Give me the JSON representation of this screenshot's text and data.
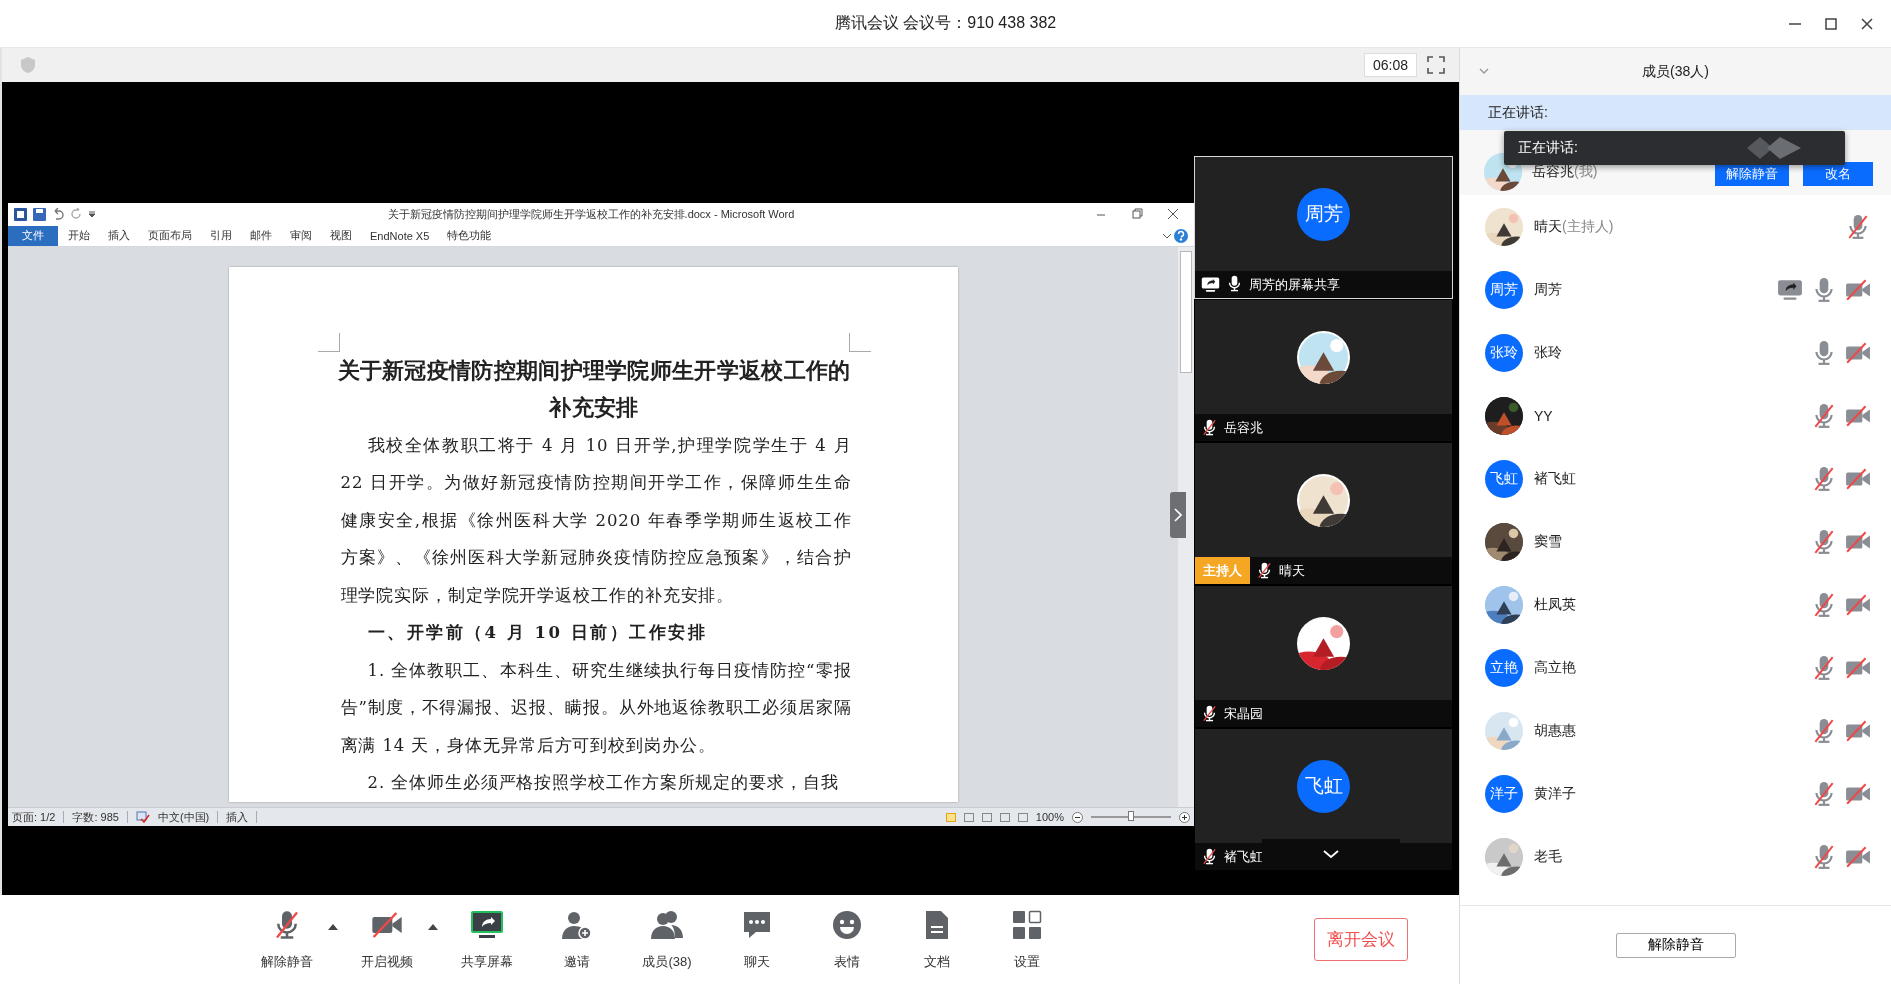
{
  "window": {
    "title": "腾讯会议 会议号：910 438 382"
  },
  "meeting_bar": {
    "timer": "06:08"
  },
  "word": {
    "title": "关于新冠疫情防控期间护理学院师生开学返校工作的补充安排.docx - Microsoft Word",
    "ribbon_tabs": [
      {
        "label": "文件",
        "selected": true
      },
      {
        "label": "开始",
        "selected": false
      },
      {
        "label": "插入",
        "selected": false
      },
      {
        "label": "页面布局",
        "selected": false
      },
      {
        "label": "引用",
        "selected": false
      },
      {
        "label": "邮件",
        "selected": false
      },
      {
        "label": "审阅",
        "selected": false
      },
      {
        "label": "视图",
        "selected": false
      },
      {
        "label": "EndNote X5",
        "selected": false
      },
      {
        "label": "特色功能",
        "selected": false
      }
    ],
    "document": [
      {
        "kind": "title",
        "text": "关于新冠疫情防控期间护理学院师生开学返校工作的补充安排"
      },
      {
        "kind": "paragraph",
        "text": "我校全体教职工将于 4 月 10 日开学,护理学院学生于 4 月 22 日开学。为做好新冠疫情防控期间开学工作，保障师生生命健康安全,根据《徐州医科大学 2020 年春季学期师生返校工作方案》、《徐州医科大学新冠肺炎疫情防控应急预案》，结合护理学院实际，制定学院开学返校工作的补充安排。"
      },
      {
        "kind": "heading",
        "text": "一、开学前（4 月 10 日前）工作安排"
      },
      {
        "kind": "paragraph",
        "text": "1. 全体教职工、本科生、研究生继续执行每日疫情防控“零报告”制度，不得漏报、迟报、瞒报。从外地返徐教职工必须居家隔离满 14 天，身体无异常后方可到校到岗办公。"
      },
      {
        "kind": "paragraph",
        "text": "2. 全体师生必须严格按照学校工作方案所规定的要求，自我"
      }
    ],
    "status_bar": {
      "page": "页面: 1/2",
      "words": "字数: 985",
      "language": "中文(中国)",
      "mode": "插入",
      "zoom": "100%",
      "views": [
        {
          "selected": true
        },
        {
          "selected": false
        },
        {
          "selected": false
        },
        {
          "selected": false
        },
        {
          "selected": false
        }
      ],
      "zoom_slider": {
        "level": 0.5
      }
    }
  },
  "video_tiles": [
    {
      "label": "周芳的屏幕共享",
      "avatar": {
        "kind": "initials",
        "text": "周芳"
      },
      "muted": false,
      "sharing": true,
      "selected": true
    },
    {
      "label": "岳容兆",
      "muted": true,
      "sharing": false,
      "selected": false
    },
    {
      "label": "晴天",
      "muted": true,
      "sharing": false,
      "badge": "主持人",
      "selected": false
    },
    {
      "label": "宋晶园",
      "muted": true,
      "sharing": false,
      "selected": false
    },
    {
      "label": "褚飞虹",
      "avatar": {
        "kind": "initials",
        "text": "飞虹"
      },
      "muted": true,
      "sharing": false,
      "selected": false
    }
  ],
  "members": {
    "title": "成员(38人)",
    "speaking_label": "正在讲话:",
    "tooltip": "正在讲话:",
    "me": {
      "name": "岳容兆",
      "suffix": "(我)",
      "buttons": [
        "解除静音",
        "改名"
      ]
    },
    "list": [
      {
        "name": "晴天",
        "suffix": "(主持人)",
        "muted": true,
        "sharing": false
      },
      {
        "name": "周芳",
        "avatar": {
          "kind": "initials",
          "text": "周芳"
        },
        "muted": false,
        "camera_off": true,
        "sharing": true
      },
      {
        "name": "张玲",
        "avatar": {
          "kind": "initials",
          "text": "张玲"
        },
        "muted": false,
        "camera_off": true,
        "sharing": false
      },
      {
        "name": "YY",
        "muted": true,
        "camera_off": true,
        "sharing": false
      },
      {
        "name": "褚飞虹",
        "avatar": {
          "kind": "initials",
          "text": "飞虹"
        },
        "muted": true,
        "camera_off": true,
        "sharing": false
      },
      {
        "name": "窦雪",
        "muted": true,
        "camera_off": true,
        "sharing": false
      },
      {
        "name": "杜凤英",
        "muted": true,
        "camera_off": true,
        "sharing": false
      },
      {
        "name": "高立艳",
        "avatar": {
          "kind": "initials",
          "text": "立艳"
        },
        "muted": true,
        "camera_off": true,
        "sharing": false
      },
      {
        "name": "胡惠惠",
        "muted": true,
        "camera_off": true,
        "sharing": false
      },
      {
        "name": "黄洋子",
        "avatar": {
          "kind": "initials",
          "text": "洋子"
        },
        "muted": true,
        "camera_off": true,
        "sharing": false
      },
      {
        "name": "老毛",
        "muted": true,
        "camera_off": true,
        "sharing": false
      }
    ],
    "footer_button": "解除静音"
  },
  "toolbar": {
    "items": [
      {
        "label": "解除静音",
        "off": true,
        "menu": true
      },
      {
        "label": "开启视频",
        "off": true,
        "menu": true
      },
      {
        "label": "共享屏幕"
      },
      {
        "label": "邀请"
      },
      {
        "label": "成员(38)"
      },
      {
        "label": "聊天"
      },
      {
        "label": "表情"
      },
      {
        "label": "文档"
      },
      {
        "label": "设置"
      }
    ],
    "leave_button": "离开会议"
  }
}
